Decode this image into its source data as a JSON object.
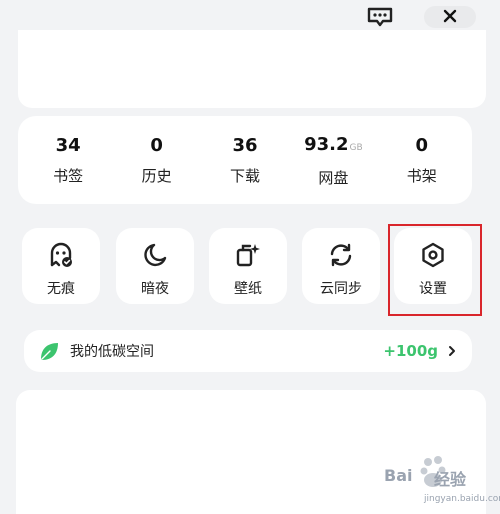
{
  "stats": [
    {
      "value": "34",
      "unit": "",
      "label": "书签"
    },
    {
      "value": "0",
      "unit": "",
      "label": "历史"
    },
    {
      "value": "36",
      "unit": "",
      "label": "下载"
    },
    {
      "value": "93.2",
      "unit": "GB",
      "label": "网盘"
    },
    {
      "value": "0",
      "unit": "",
      "label": "书架"
    }
  ],
  "tools": [
    {
      "label": "无痕",
      "icon": "ghost-icon"
    },
    {
      "label": "暗夜",
      "icon": "moon-icon"
    },
    {
      "label": "壁纸",
      "icon": "wallpaper-icon"
    },
    {
      "label": "云同步",
      "icon": "sync-icon"
    },
    {
      "label": "设置",
      "icon": "settings-icon"
    }
  ],
  "carbon": {
    "title": "我的低碳空间",
    "value": "+100g"
  },
  "watermark": {
    "brand": "Bai",
    "mark": "经验",
    "sub": "jingyan.baidu.com"
  },
  "colors": {
    "accent_green": "#3cc46e",
    "highlight_red": "#d9252b"
  }
}
